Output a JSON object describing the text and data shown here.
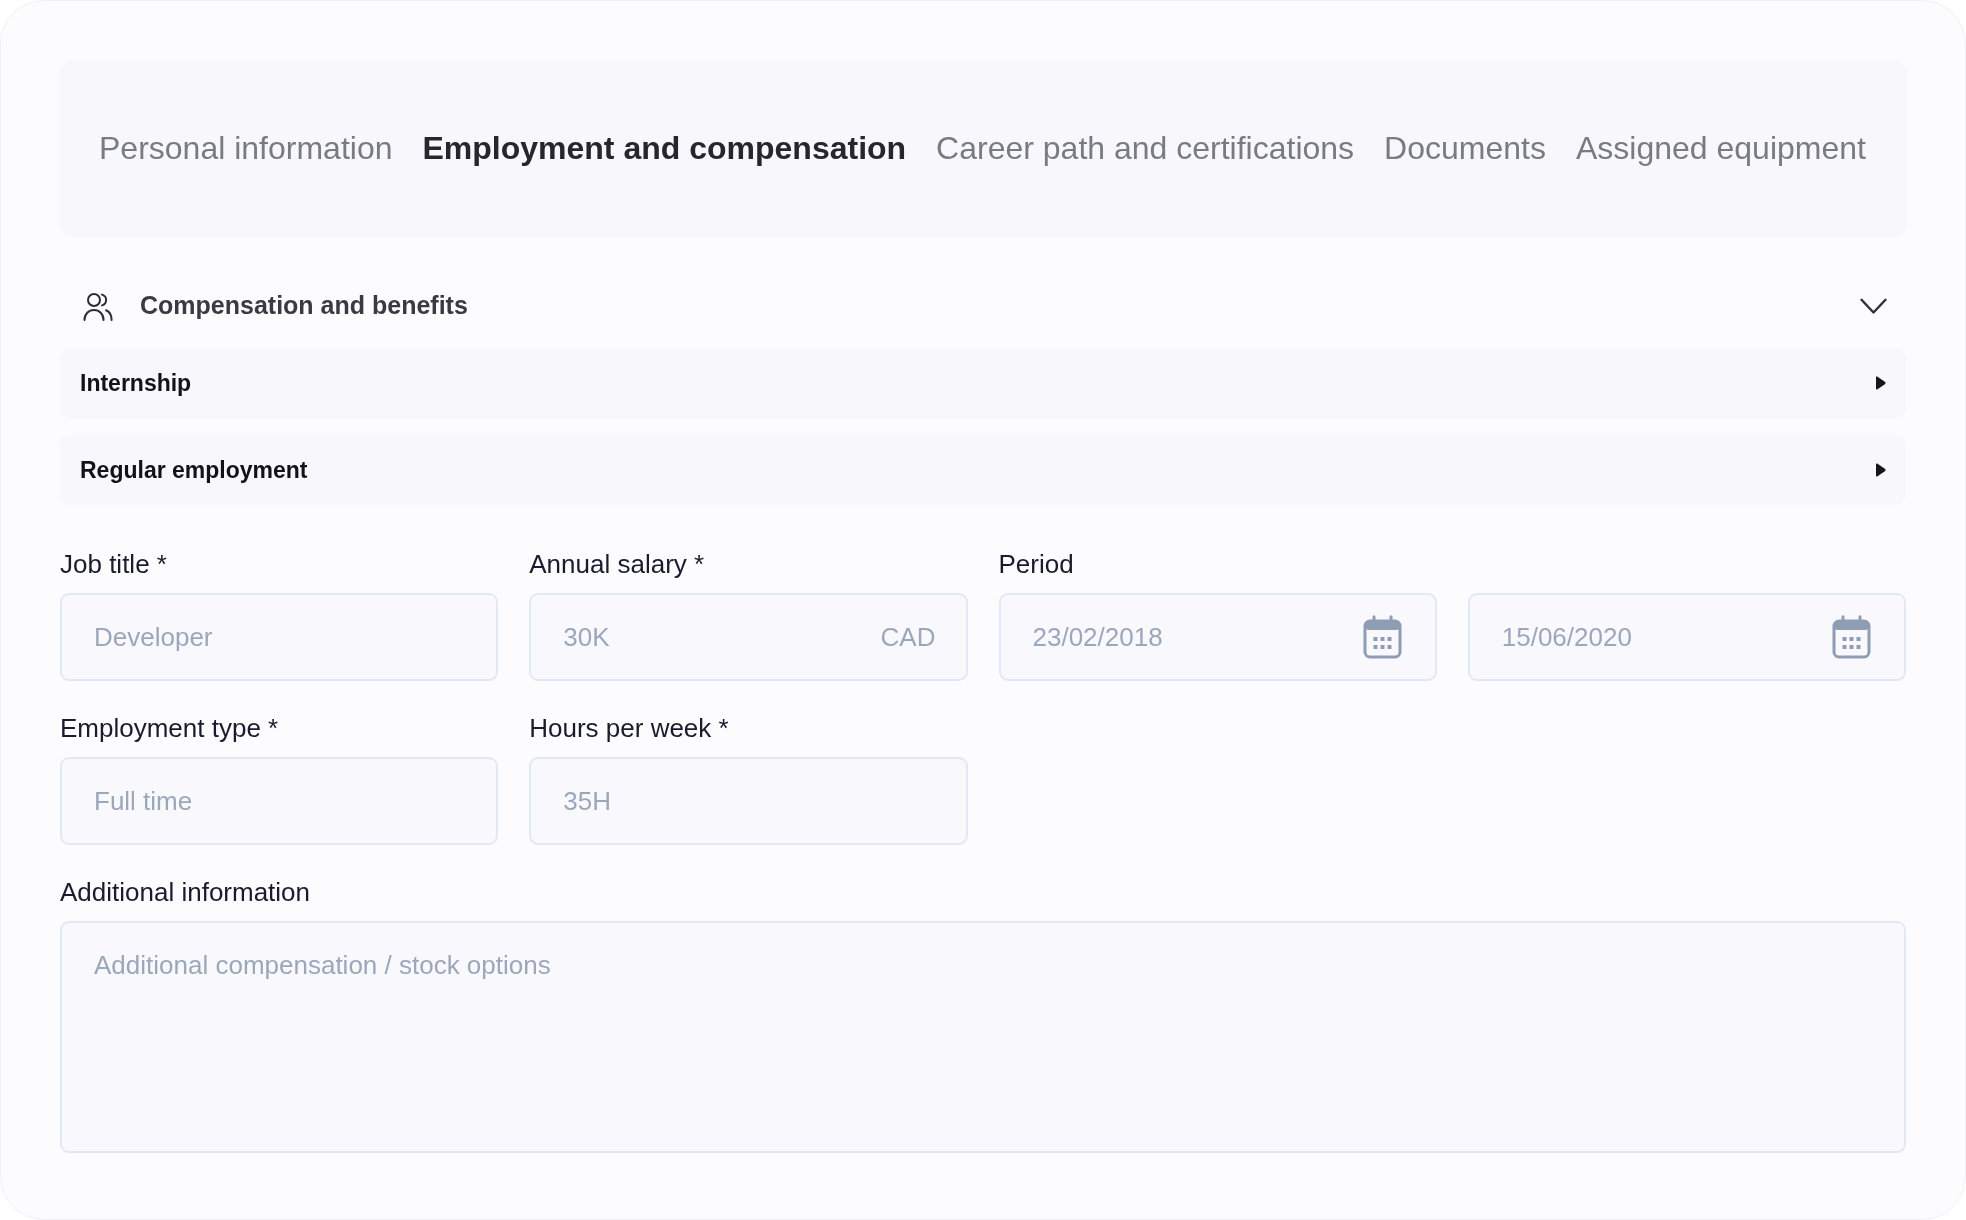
{
  "tabs": [
    {
      "label": "Personal information",
      "selected": false
    },
    {
      "label": "Employment and compensation",
      "selected": true
    },
    {
      "label": "Career path and certifications",
      "selected": false
    },
    {
      "label": "Documents",
      "selected": false
    },
    {
      "label": "Assigned equipment",
      "selected": false
    }
  ],
  "section": {
    "title": "Compensation and benefits",
    "expanded": true,
    "subsections": [
      {
        "title": "Internship",
        "expanded": false
      },
      {
        "title": "Regular employment",
        "expanded": false
      }
    ],
    "fields": [
      {
        "kind": "text",
        "label": "Job title *",
        "placeholder": "Developer"
      },
      {
        "kind": "suffixed",
        "label": "Annual salary *",
        "placeholder": "30K",
        "suffix": "CAD"
      },
      {
        "kind": "date_range",
        "label": "Period",
        "start": {
          "placeholder": "23/02/2018"
        },
        "end": {
          "placeholder": "15/06/2020"
        }
      },
      {
        "kind": "text",
        "label": "Employment type *",
        "placeholder": "Full time"
      },
      {
        "kind": "text",
        "label": "Hours per week *",
        "placeholder": "35H"
      },
      {
        "kind": "textarea",
        "label": "Additional information",
        "placeholder": "Additional compensation / stock options"
      }
    ]
  }
}
